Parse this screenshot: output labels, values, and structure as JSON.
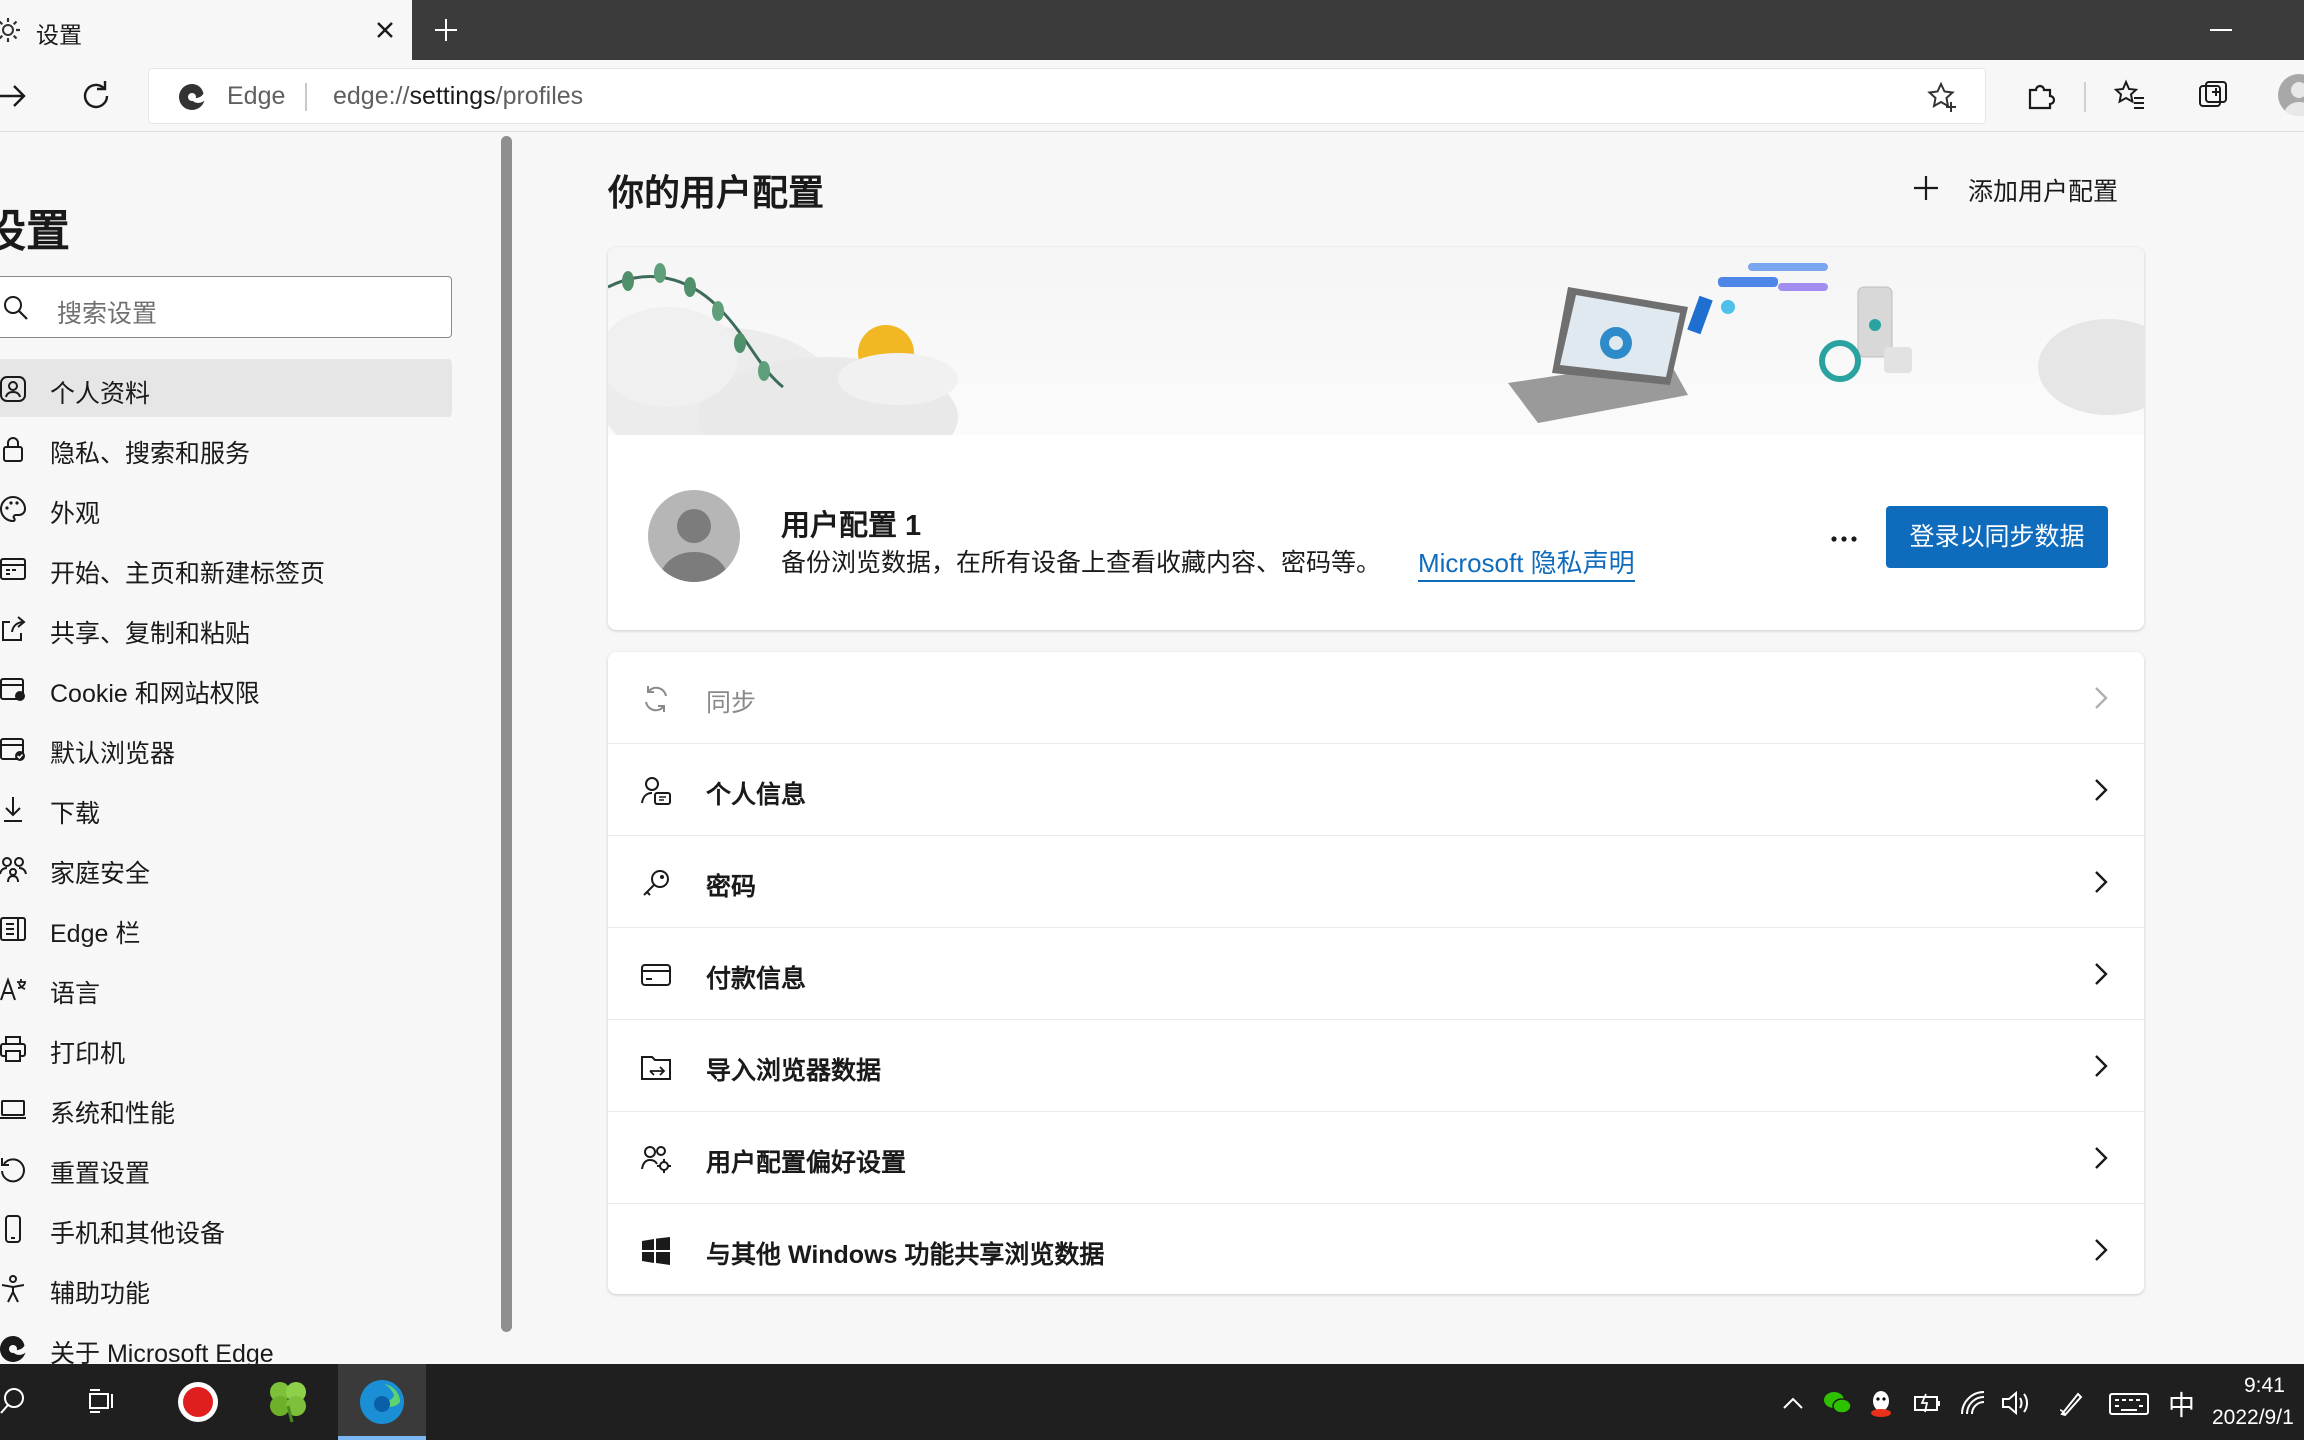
{
  "browser": {
    "tab_title": "设置",
    "address_label": "Edge",
    "url_prefix": "edge://",
    "url_bold": "settings",
    "url_suffix": "/profiles"
  },
  "sidebar": {
    "title": "设置",
    "search_placeholder": "搜索设置",
    "items": [
      {
        "label": "个人资料",
        "icon": "profile-icon",
        "active": true
      },
      {
        "label": "隐私、搜索和服务",
        "icon": "lock-icon"
      },
      {
        "label": "外观",
        "icon": "palette-icon"
      },
      {
        "label": "开始、主页和新建标签页",
        "icon": "home-icon"
      },
      {
        "label": "共享、复制和粘贴",
        "icon": "share-icon"
      },
      {
        "label": "Cookie 和网站权限",
        "icon": "cookie-icon"
      },
      {
        "label": "默认浏览器",
        "icon": "browser-icon"
      },
      {
        "label": "下载",
        "icon": "download-icon"
      },
      {
        "label": "家庭安全",
        "icon": "family-icon"
      },
      {
        "label": "Edge 栏",
        "icon": "edge-bar-icon"
      },
      {
        "label": "语言",
        "icon": "language-icon"
      },
      {
        "label": "打印机",
        "icon": "printer-icon"
      },
      {
        "label": "系统和性能",
        "icon": "laptop-icon"
      },
      {
        "label": "重置设置",
        "icon": "reset-icon"
      },
      {
        "label": "手机和其他设备",
        "icon": "phone-icon"
      },
      {
        "label": "辅助功能",
        "icon": "accessibility-icon"
      },
      {
        "label": "关于 Microsoft Edge",
        "icon": "edge-logo-icon"
      }
    ]
  },
  "main": {
    "title": "你的用户配置",
    "add_profile_label": "添加用户配置",
    "profile": {
      "name": "用户配置 1",
      "description": "备份浏览数据，在所有设备上查看收藏内容、密码等。",
      "privacy_link": "Microsoft 隐私声明",
      "more_label": "···",
      "sync_button": "登录以同步数据"
    },
    "rows": [
      {
        "label": "同步",
        "icon": "sync-icon",
        "disabled": true
      },
      {
        "label": "个人信息",
        "icon": "personal-info-icon"
      },
      {
        "label": "密码",
        "icon": "key-icon"
      },
      {
        "label": "付款信息",
        "icon": "card-icon"
      },
      {
        "label": "导入浏览器数据",
        "icon": "import-icon"
      },
      {
        "label": "用户配置偏好设置",
        "icon": "profile-settings-icon"
      },
      {
        "label": "与其他 Windows 功能共享浏览数据",
        "icon": "windows-icon"
      }
    ]
  },
  "taskbar": {
    "ime": "中",
    "time": "9:41",
    "date": "2022/9/1"
  },
  "colors": {
    "accent": "#0f6cbd",
    "titlebar": "#3b3b3b",
    "taskbar": "#1f1f1f"
  }
}
